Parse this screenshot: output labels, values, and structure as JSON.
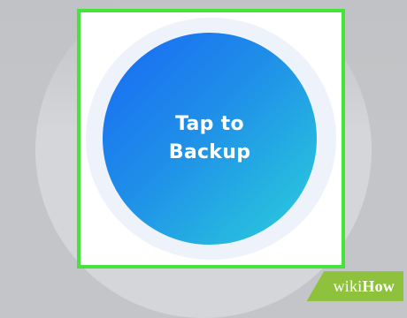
{
  "backup_button": {
    "line1": "Tap to",
    "line2": "Backup"
  },
  "watermark": {
    "part1": "wiki",
    "part2": "How"
  },
  "colors": {
    "highlight": "#45e33c",
    "gradient_start": "#1869f4",
    "gradient_end": "#2bd0dc",
    "ring": "#eef2fb",
    "background": "#c3c5c8",
    "watermark_bg": "#8ec23d"
  }
}
